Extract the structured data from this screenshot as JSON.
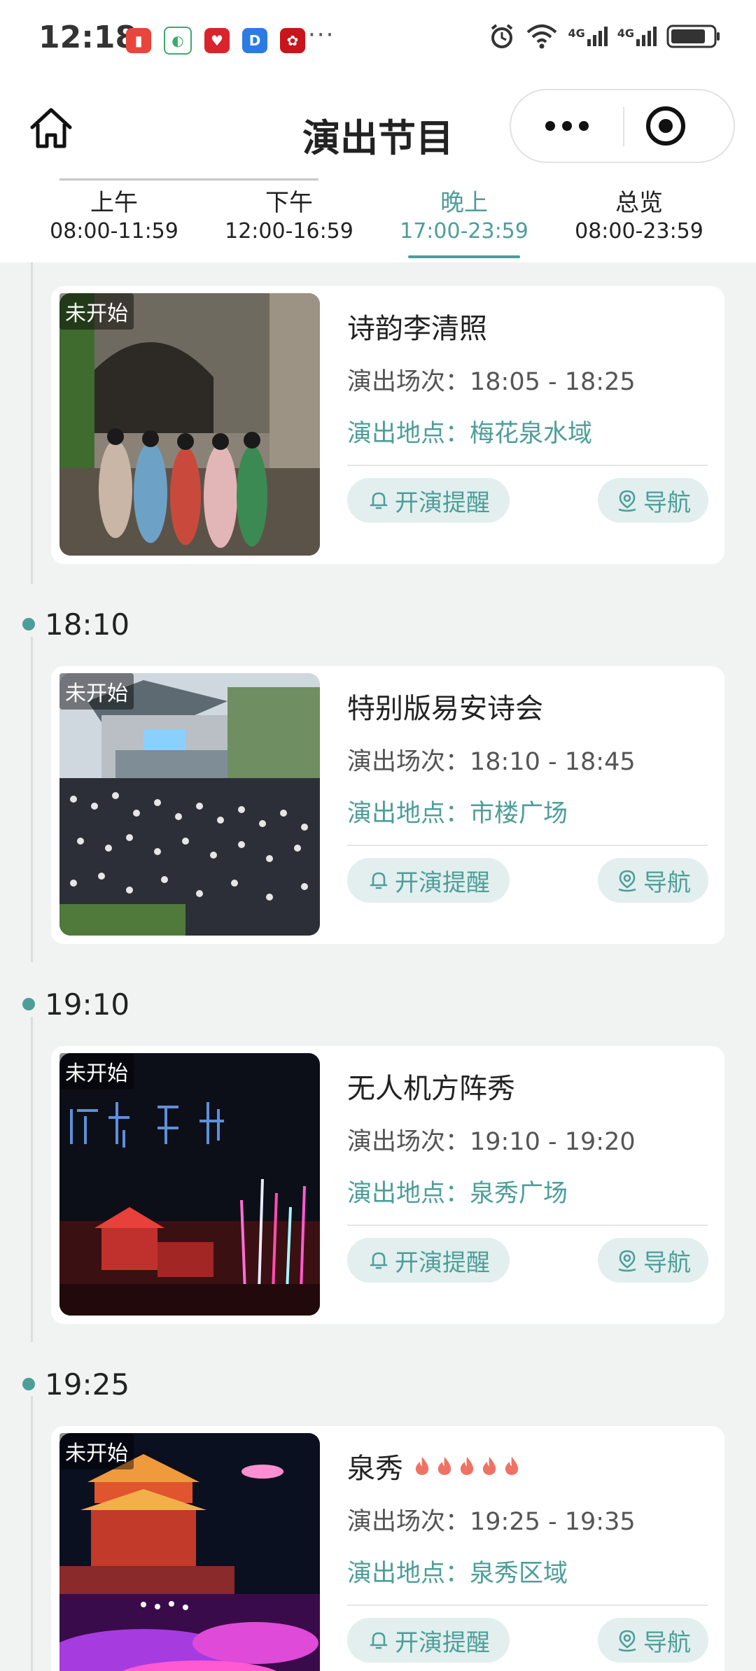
{
  "status_bar": {
    "time": "12:18",
    "dots": "···",
    "signal_1": "4G",
    "signal_2": "4G",
    "app_icons": [
      "red-book-app-icon",
      "green-app-icon",
      "red-heart-app-icon",
      "blue-d-app-icon",
      "red-app-icon"
    ]
  },
  "header": {
    "title": "演出节目"
  },
  "tabs": [
    {
      "label": "上午",
      "range": "08:00-11:59",
      "active": false
    },
    {
      "label": "下午",
      "range": "12:00-16:59",
      "active": false
    },
    {
      "label": "晚上",
      "range": "17:00-23:59",
      "active": true
    },
    {
      "label": "总览",
      "range": "08:00-23:59",
      "active": false
    }
  ],
  "labels": {
    "time_prefix": "演出场次：",
    "loc_prefix": "演出地点：",
    "remind": "开演提醒",
    "nav": "导航"
  },
  "events": [
    {
      "time_label": "",
      "status": "未开始",
      "title": "诗韵李清照",
      "hot": 0,
      "time": "18:05 - 18:25",
      "location": "梅花泉水域",
      "image": "women-in-hanfu-at-stone-archway"
    },
    {
      "time_label": "18:10",
      "status": "未开始",
      "title": "特别版易安诗会",
      "hot": 0,
      "time": "18:10 - 18:45",
      "location": "市楼广场",
      "image": "crowd-at-stage-square"
    },
    {
      "time_label": "19:10",
      "status": "未开始",
      "title": "无人机方阵秀",
      "hot": 0,
      "time": "19:10 - 19:20",
      "location": "泉秀广场",
      "image": "drone-show-night-fountain"
    },
    {
      "time_label": "19:25",
      "status": "未开始",
      "title": "泉秀",
      "hot": 5,
      "time": "19:25 - 19:35",
      "location": "泉秀区域",
      "image": "illuminated-tower-night-show"
    }
  ],
  "colors": {
    "accent": "#4d9e9a",
    "button_bg": "#e2efee",
    "page_bg": "#f1f3f2"
  }
}
